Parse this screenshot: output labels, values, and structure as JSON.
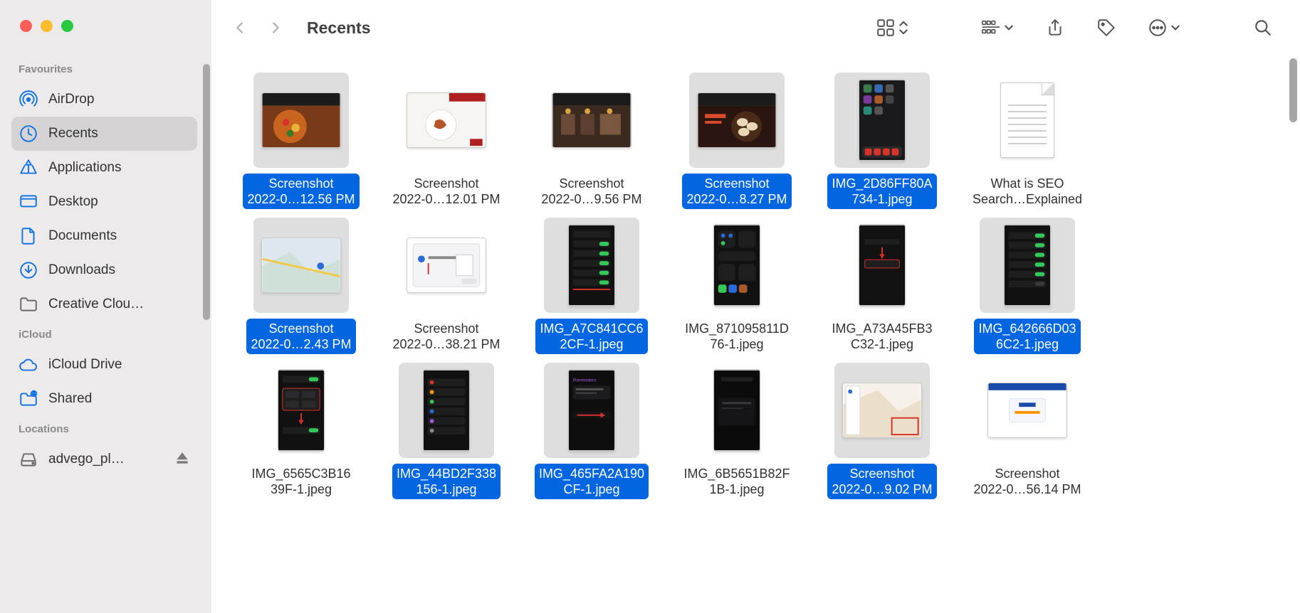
{
  "window_title": "Recents",
  "sidebar": {
    "sections": [
      {
        "title": "Favourites",
        "items": [
          {
            "icon": "airdrop",
            "label": "AirDrop",
            "selected": false
          },
          {
            "icon": "recents",
            "label": "Recents",
            "selected": true
          },
          {
            "icon": "apps",
            "label": "Applications",
            "selected": false
          },
          {
            "icon": "desktop",
            "label": "Desktop",
            "selected": false
          },
          {
            "icon": "documents",
            "label": "Documents",
            "selected": false
          },
          {
            "icon": "downloads",
            "label": "Downloads",
            "selected": false
          },
          {
            "icon": "folder",
            "label": "Creative Clou…",
            "selected": false,
            "grey": true
          }
        ]
      },
      {
        "title": "iCloud",
        "items": [
          {
            "icon": "icloud",
            "label": "iCloud Drive",
            "selected": false
          },
          {
            "icon": "shared",
            "label": "Shared",
            "selected": false
          }
        ]
      },
      {
        "title": "Locations",
        "items": [
          {
            "icon": "disk",
            "label": "advego_pl…",
            "selected": false,
            "grey": true,
            "eject": true
          }
        ]
      }
    ]
  },
  "files": [
    {
      "line1": "Screenshot",
      "line2": "2022-0…12.56 PM",
      "selected": true,
      "thumb": "wide",
      "art": "food-banner"
    },
    {
      "line1": "Screenshot",
      "line2": "2022-0…12.01 PM",
      "selected": false,
      "thumb": "wide",
      "art": "prawns"
    },
    {
      "line1": "Screenshot",
      "line2": "2022-0…9.56 PM",
      "selected": false,
      "thumb": "wide",
      "art": "restaurant"
    },
    {
      "line1": "Screenshot",
      "line2": "2022-0…8.27 PM",
      "selected": true,
      "thumb": "wide",
      "art": "dumplings"
    },
    {
      "line1": "IMG_2D86FF80A",
      "line2": "734-1.jpeg",
      "selected": true,
      "thumb": "tall",
      "art": "homescreen"
    },
    {
      "line1": "What is SEO",
      "line2": "Search…Explained",
      "selected": false,
      "thumb": "doc",
      "art": "doc"
    },
    {
      "line1": "Screenshot",
      "line2": "2022-0…2.43 PM",
      "selected": true,
      "thumb": "wide",
      "art": "map"
    },
    {
      "line1": "Screenshot",
      "line2": "2022-0…38.21 PM",
      "selected": false,
      "thumb": "wide",
      "art": "dialog"
    },
    {
      "line1": "IMG_A7C841CC6",
      "line2": "2CF-1.jpeg",
      "selected": true,
      "thumb": "tall",
      "art": "toggles"
    },
    {
      "line1": "IMG_871095811D",
      "line2": "76-1.jpeg",
      "selected": false,
      "thumb": "tall",
      "art": "control"
    },
    {
      "line1": "IMG_A73A45FB3",
      "line2": "C32-1.jpeg",
      "selected": false,
      "thumb": "tall",
      "art": "dark-red"
    },
    {
      "line1": "IMG_642666D03",
      "line2": "6C2-1.jpeg",
      "selected": true,
      "thumb": "tall",
      "art": "toggles2"
    },
    {
      "line1": "IMG_6565C3B16",
      "line2": "39F-1.jpeg",
      "selected": false,
      "thumb": "tall",
      "art": "dark-boxes"
    },
    {
      "line1": "IMG_44BD2F338",
      "line2": "156-1.jpeg",
      "selected": true,
      "thumb": "tall",
      "art": "dark-list"
    },
    {
      "line1": "IMG_465FA2A190",
      "line2": "CF-1.jpeg",
      "selected": true,
      "thumb": "tall",
      "art": "reminders"
    },
    {
      "line1": "IMG_6B5651B82F",
      "line2": "1B-1.jpeg",
      "selected": false,
      "thumb": "tall",
      "art": "update"
    },
    {
      "line1": "Screenshot",
      "line2": "2022-0…9.02 PM",
      "selected": true,
      "thumb": "wide",
      "art": "map2"
    },
    {
      "line1": "Screenshot",
      "line2": "2022-0…56.14 PM",
      "selected": false,
      "thumb": "wide",
      "art": "webapp"
    }
  ]
}
